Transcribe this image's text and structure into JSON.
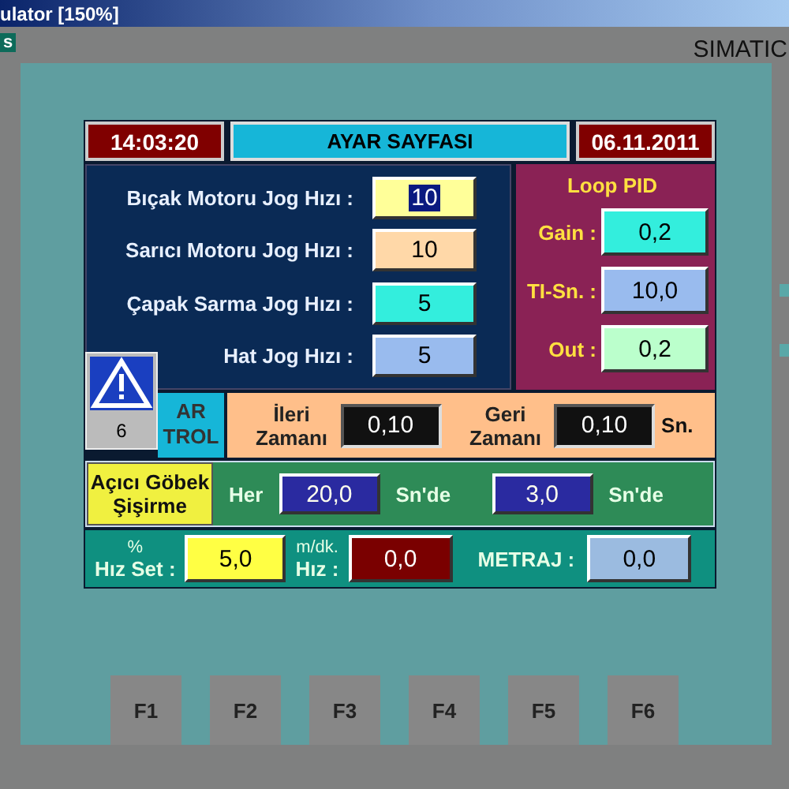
{
  "window": {
    "title": "ulator [150%]"
  },
  "panel": {
    "tag": "s",
    "brand": "SIMATIC"
  },
  "screen": {
    "time": "14:03:20",
    "title": "AYAR SAYFASI",
    "date": "06.11.2011",
    "jog_speeds": [
      {
        "label": "Bıçak Motoru Jog Hızı :",
        "value": "10",
        "color": "#ffff99",
        "focused": true
      },
      {
        "label": "Sarıcı Motoru Jog Hızı :",
        "value": "10",
        "color": "#ffd8a8",
        "focused": false
      },
      {
        "label": "Çapak Sarma Jog Hızı :",
        "value": "5",
        "color": "#33eedd",
        "focused": false
      },
      {
        "label": "Hat Jog Hızı :",
        "value": "5",
        "color": "#99bbee",
        "focused": false
      }
    ],
    "loop_pid": {
      "title": "Loop PID",
      "params": [
        {
          "label": "Gain :",
          "value": "0,2",
          "color": "#33eedd"
        },
        {
          "label": "TI-Sn. :",
          "value": "10,0",
          "color": "#99bbee"
        },
        {
          "label": "Out :",
          "value": "0,2",
          "color": "#bbffcc"
        }
      ]
    },
    "alarm": {
      "count": "6"
    },
    "control": {
      "text": "AR\nTROL"
    },
    "timing": [
      {
        "label": "İleri\nZamanı",
        "value": "0,10"
      },
      {
        "label": "Geri\nZamanı",
        "value": "0,10"
      }
    ],
    "timing_unit": "Sn.",
    "inflate": {
      "button": "Açıcı Göbek\nŞişirme",
      "every_label": "Her",
      "every": "20,0",
      "every_unit": "Sn'de",
      "duration": "3,0",
      "duration_unit": "Sn'de"
    },
    "speed": {
      "set_unit": "%",
      "set_label": "Hız Set :",
      "set_value": "5,0",
      "speed_unit": "m/dk.",
      "speed_label": "Hız :",
      "speed_value": "0,0",
      "metraj_label": "METRAJ :",
      "metraj_value": "0,0"
    }
  },
  "function_keys": [
    "F1",
    "F2",
    "F3",
    "F4",
    "F5",
    "F6"
  ]
}
